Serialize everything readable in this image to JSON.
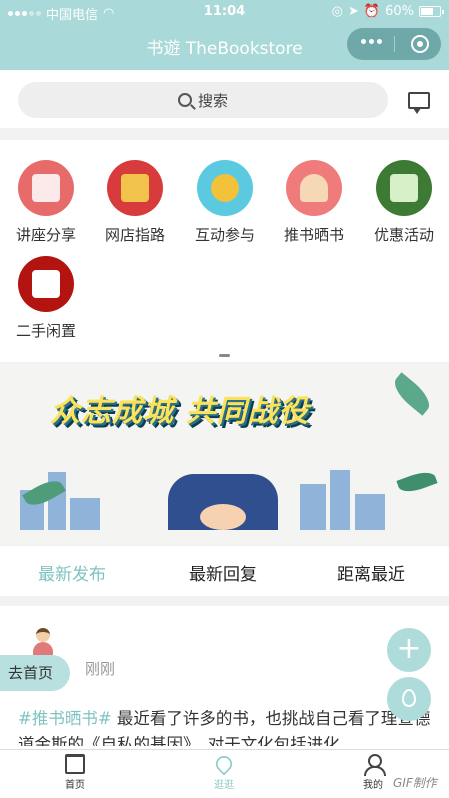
{
  "status_bar": {
    "carrier": "中国电信",
    "time": "11:04",
    "battery": "60%"
  },
  "nav": {
    "title": "书遊 TheBookstore"
  },
  "search": {
    "placeholder": "搜索"
  },
  "menu": {
    "items": [
      {
        "label": "讲座分享",
        "icon": "lecture-icon",
        "color": "#e86b6b"
      },
      {
        "label": "网店指路",
        "icon": "store-icon",
        "color": "#d83b3b"
      },
      {
        "label": "互动参与",
        "icon": "interact-icon",
        "color": "#5bc9e0"
      },
      {
        "label": "推书晒书",
        "icon": "reader-icon",
        "color": "#f07b7b"
      },
      {
        "label": "优惠活动",
        "icon": "coupon-icon",
        "color": "#3d7a33"
      },
      {
        "label": "二手闲置",
        "icon": "secondhand-icon",
        "color": "#b3140f"
      }
    ]
  },
  "banner": {
    "slogan": "众志成城 共同战役"
  },
  "tabs": [
    {
      "label": "最新发布",
      "active": true
    },
    {
      "label": "最新回复",
      "active": false
    },
    {
      "label": "距离最近",
      "active": false
    }
  ],
  "post": {
    "time": "刚刚",
    "tag": "#推书晒书#",
    "text": " 最近看了许多的书，也挑战自己看了理查德道金斯的《自私的基因》，对于文化包括进化"
  },
  "home_button": "去首页",
  "fab_plus": "+",
  "bottom_nav": [
    {
      "label": "首页",
      "icon": "home-icon"
    },
    {
      "label": "逛逛",
      "icon": "location-icon"
    },
    {
      "label": "我的",
      "icon": "user-icon"
    }
  ],
  "watermark": "GIF制作"
}
